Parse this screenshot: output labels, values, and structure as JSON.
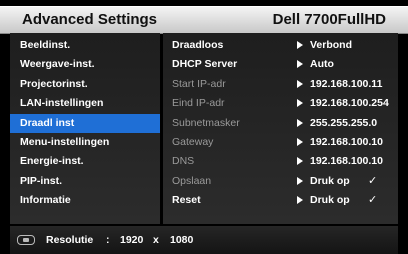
{
  "header": {
    "title": "Advanced Settings",
    "model": "Dell 7700FullHD"
  },
  "menu": [
    {
      "label": "Beeldinst."
    },
    {
      "label": "Weergave-inst."
    },
    {
      "label": "Projectorinst."
    },
    {
      "label": "LAN-instellingen"
    },
    {
      "label": "Draadl inst"
    },
    {
      "label": "Menu-instellingen"
    },
    {
      "label": "Energie-inst."
    },
    {
      "label": "PIP-inst."
    },
    {
      "label": "Informatie"
    }
  ],
  "active_menu_index": 4,
  "settings": [
    {
      "label": "Draadloos",
      "value": "Verbond"
    },
    {
      "label": "DHCP Server",
      "value": "Auto"
    },
    {
      "label": "Start IP-adr",
      "value": "192.168.100.11"
    },
    {
      "label": "Eind IP-adr",
      "value": "192.168.100.254"
    },
    {
      "label": "Subnetmasker",
      "value": "255.255.255.0"
    },
    {
      "label": "Gateway",
      "value": "192.168.100.10"
    },
    {
      "label": "DNS",
      "value": "192.168.100.10"
    },
    {
      "label": "Opslaan",
      "value": "Druk op",
      "check": "✓"
    },
    {
      "label": "Reset",
      "value": "Druk op",
      "check": "✓"
    }
  ],
  "footer": {
    "label": "Resolutie",
    "sep": ":",
    "width": "1920",
    "x": "x",
    "height": "1080"
  },
  "colors": {
    "highlight": "#1f6fd6",
    "dim_text": "#9a9a9a"
  }
}
